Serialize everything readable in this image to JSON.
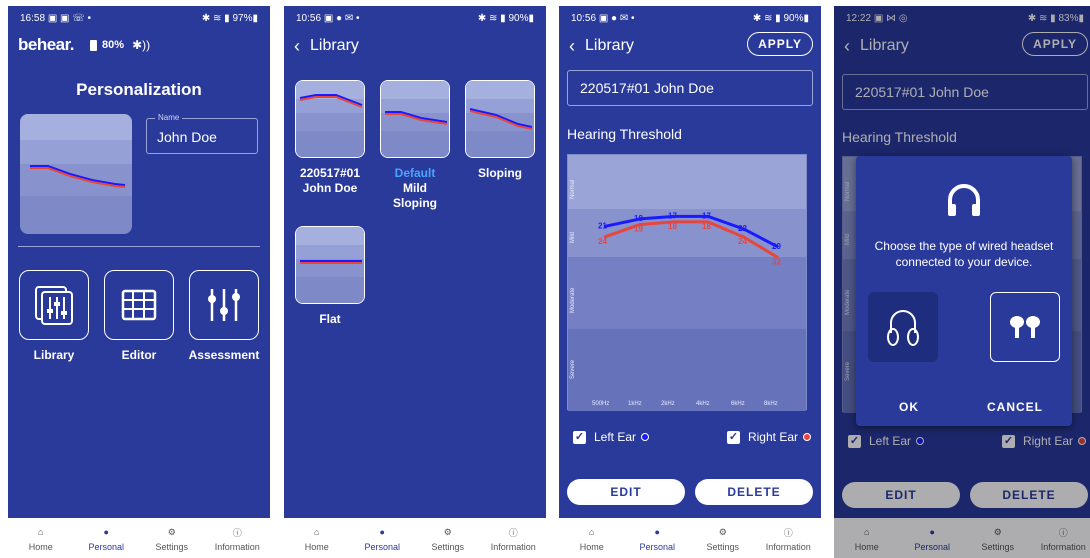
{
  "phone1": {
    "status": {
      "time": "16:58",
      "icons_left": "▣ ▣ ☏ •",
      "battery": "97%"
    },
    "brand": "behear.",
    "device_battery": "80%",
    "title": "Personalization",
    "name_label": "Name",
    "name_value": "John Doe",
    "tiles": [
      {
        "label": "Library"
      },
      {
        "label": "Editor"
      },
      {
        "label": "Assessment"
      }
    ]
  },
  "phone2": {
    "status": {
      "time": "10:56",
      "icons_left": "▣ ● ✉ •",
      "battery": "90%"
    },
    "title": "Library",
    "presets": [
      {
        "line1": "220517#01",
        "line2": "John Doe",
        "line3": ""
      },
      {
        "line1": "Default",
        "line2": "Mild",
        "line3": "Sloping"
      },
      {
        "line1": "Sloping",
        "line2": "",
        "line3": ""
      },
      {
        "line1": "Flat",
        "line2": "",
        "line3": ""
      }
    ]
  },
  "phone3": {
    "status": {
      "time": "10:56",
      "icons_left": "▣ ● ✉ •",
      "battery": "90%"
    },
    "title": "Library",
    "apply": "APPLY",
    "name_value": "220517#01 John Doe",
    "section_title": "Hearing Threshold",
    "bands": [
      "Normal",
      "Mild",
      "Moderate",
      "Severe"
    ],
    "frequencies": [
      "500Hz",
      "1kHz",
      "2kHz",
      "4kHz",
      "6kHz",
      "8kHz"
    ],
    "left_values": [
      21,
      18,
      17,
      17,
      22,
      29
    ],
    "right_values": [
      24,
      19,
      18,
      18,
      24,
      32
    ],
    "left_ear": "Left Ear",
    "right_ear": "Right Ear",
    "edit": "EDIT",
    "delete": "DELETE"
  },
  "phone4": {
    "status": {
      "time": "12:22",
      "icons_left": "▣ ⋈ ◎",
      "battery": "83%"
    },
    "title": "Library",
    "apply": "APPLY",
    "name_value": "220517#01 John Doe",
    "section_title": "Hearing Threshold",
    "bands": [
      "Normal",
      "Mild",
      "Moderate",
      "Severe"
    ],
    "left_ear": "Left Ear",
    "right_ear": "Right Ear",
    "edit": "EDIT",
    "delete": "DELETE",
    "dialog": {
      "message": "Choose the type of wired headset connected to your device.",
      "ok": "OK",
      "cancel": "CANCEL"
    }
  },
  "nav": [
    {
      "label": "Home"
    },
    {
      "label": "Personal"
    },
    {
      "label": "Settings"
    },
    {
      "label": "Information"
    }
  ],
  "colors": {
    "primary": "#2a3a9a",
    "left_ear": "#1a1aff",
    "right_ear": "#e8453c",
    "accent_text": "#4aa3ff"
  }
}
